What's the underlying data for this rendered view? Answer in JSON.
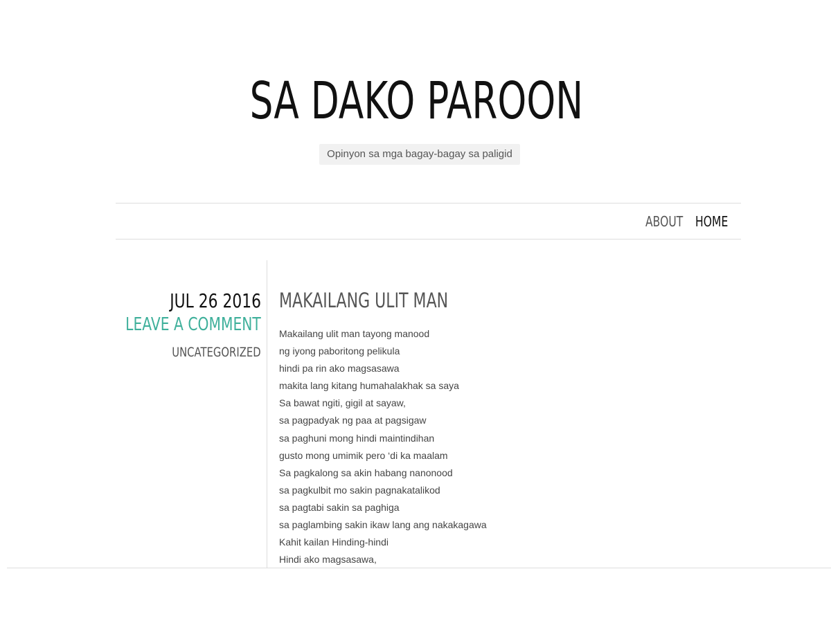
{
  "site": {
    "title": "SA DAKO PAROON",
    "tagline": "Opinyon sa mga bagay-bagay sa paligid"
  },
  "nav": {
    "items": [
      {
        "label": "ABOUT"
      },
      {
        "label": "HOME"
      }
    ]
  },
  "post": {
    "date": "JUL 26 2016",
    "comment_link": "LEAVE A COMMENT",
    "category": "UNCATEGORIZED",
    "title": "MAKAILANG ULIT MAN",
    "lines": [
      "Makailang ulit man tayong manood",
      "ng iyong paboritong pelikula",
      "hindi pa rin ako magsasawa",
      "makita lang kitang humahalakhak sa saya",
      "Sa bawat ngiti, gigil at sayaw,",
      "sa pagpadyak ng paa at pagsigaw",
      "sa paghuni mong hindi maintindihan",
      "gusto mong umimik pero ‘di ka maalam",
      "Sa pagkalong sa akin habang nanonood",
      "sa pagkulbit mo sakin pagnakatalikod",
      "sa pagtabi sakin sa paghiga",
      "sa paglambing sakin ikaw lang ang nakakagawa",
      "Kahit kailan Hinding-hindi",
      "Hindi ako magsasawa,"
    ]
  },
  "colors": {
    "accent": "#3fb09b",
    "title": "#111111",
    "muted": "#555555",
    "rule": "#dddddd"
  }
}
